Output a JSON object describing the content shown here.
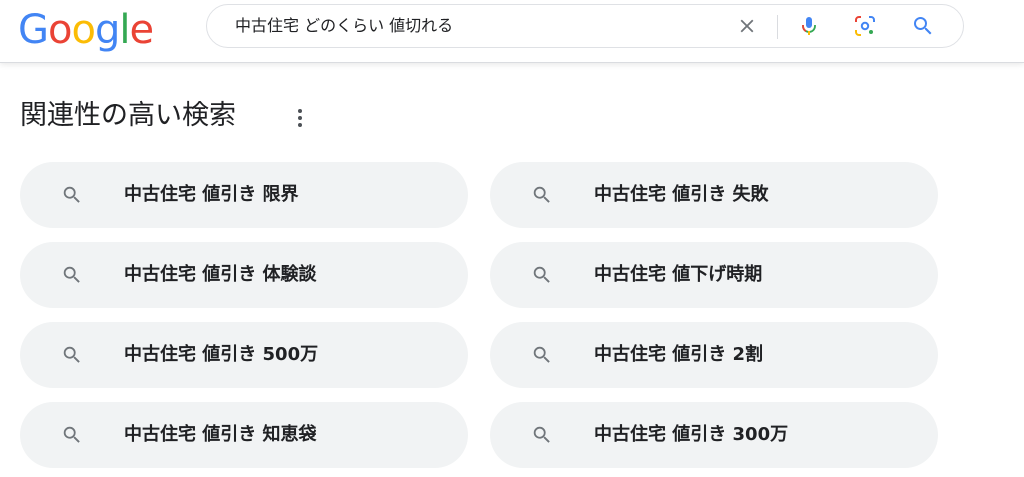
{
  "header": {
    "logo_letters": [
      "G",
      "o",
      "o",
      "g",
      "l",
      "e"
    ],
    "logo_colors": [
      "#4285f4",
      "#ea4335",
      "#fbbc05",
      "#4285f4",
      "#34a853",
      "#ea4335"
    ],
    "search_query": "中古住宅 どのくらい 値切れる"
  },
  "icons": {
    "clear": "close-icon",
    "mic": "microphone-icon",
    "lens": "camera-lens-icon",
    "search": "search-icon",
    "more": "more-vertical-icon"
  },
  "related": {
    "title": "関連性の高い検索",
    "items": [
      {
        "label": "中古住宅 値引き 限界"
      },
      {
        "label": "中古住宅 値引き 失敗"
      },
      {
        "label": "中古住宅 値引き 体験談"
      },
      {
        "label": "中古住宅 値下げ時期"
      },
      {
        "label": "中古住宅 値引き 500万"
      },
      {
        "label": "中古住宅 値引き 2割"
      },
      {
        "label": "中古住宅 値引き 知恵袋"
      },
      {
        "label": "中古住宅 値引き 300万"
      }
    ]
  },
  "colors": {
    "chip_bg": "#f1f3f4",
    "text": "#202124",
    "icon_gray": "#70757a",
    "search_blue": "#4285f4"
  }
}
